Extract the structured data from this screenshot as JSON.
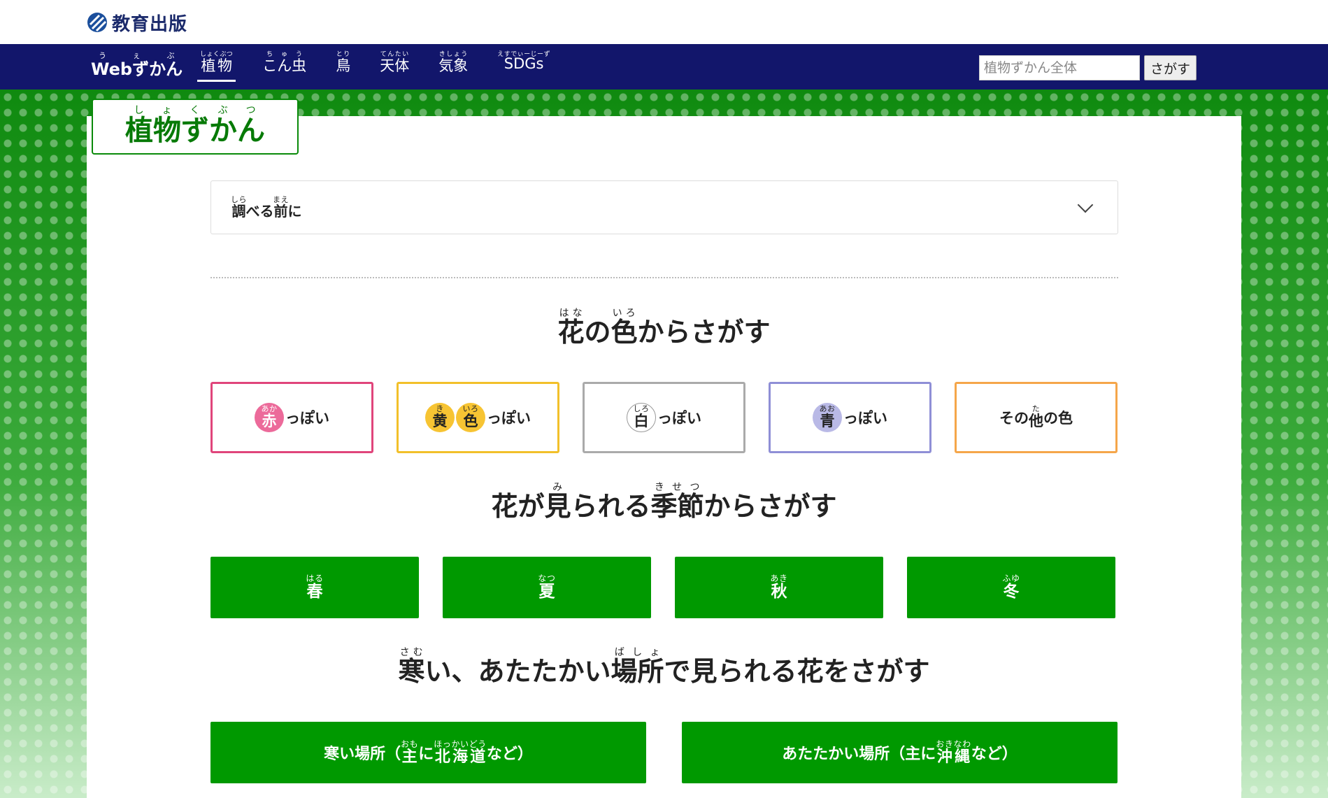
{
  "header": {
    "logo_text": "教育出版",
    "logo_color": "#1b2a6b"
  },
  "nav": {
    "brand": {
      "base": "Webずかん",
      "ruby": "うぇぶ"
    },
    "bg_color": "#12166b",
    "items": [
      {
        "label": "植物",
        "ruby": "しょくぶつ",
        "active": true
      },
      {
        "label": "こん虫",
        "ruby": "ちゅう",
        "active": false
      },
      {
        "label": "鳥",
        "ruby": "とり",
        "active": false
      },
      {
        "label": "天体",
        "ruby": "てんたい",
        "active": false
      },
      {
        "label": "気象",
        "ruby": "きしょう",
        "active": false
      },
      {
        "label": "SDGs",
        "ruby": "えすでぃーじーず",
        "active": false
      }
    ],
    "search": {
      "placeholder": "植物ずかん全体",
      "button_label": "さがす"
    }
  },
  "page_title": {
    "base": "植物ずかん",
    "ruby": "しょくぶつ"
  },
  "accordion": {
    "kanji1": "調",
    "ruby1": "しら",
    "kana1": "べる",
    "kanji2": "前",
    "ruby2": "まえ",
    "kana2": "に"
  },
  "color_section": {
    "heading": {
      "k1": "花",
      "r1": "はな",
      "mid": "の",
      "k2": "色",
      "r2": "いろ",
      "tail": "からさがす"
    },
    "buttons": [
      {
        "kanji": "赤",
        "ruby": "あか",
        "suffix": "っぽい",
        "border": "#e0457b",
        "dot": "#ec6a9a"
      },
      {
        "kanji": "黄",
        "ruby": "き",
        "kanji2": "色",
        "ruby2": "いろ",
        "suffix": "っぽい",
        "border": "#f2c02a",
        "dot": "#f7c433"
      },
      {
        "kanji": "白",
        "ruby": "しろ",
        "suffix": "っぽい",
        "border": "#aaaaaa",
        "dot": "#ffffff"
      },
      {
        "kanji": "青",
        "ruby": "あお",
        "suffix": "っぽい",
        "border": "#8f8fd6",
        "dot": "#b9b9e6"
      },
      {
        "prefix": "その",
        "kanji": "他",
        "ruby": "た",
        "suffix": "の色",
        "border": "#f5a64a"
      }
    ]
  },
  "season_section": {
    "heading": {
      "k1": "花",
      "mid1": "が",
      "k2": "見",
      "r2": "み",
      "mid2": "られる",
      "k3": "季節",
      "r3": "きせつ",
      "tail": "からさがす"
    },
    "buttons": [
      {
        "label": "春",
        "ruby": "はる"
      },
      {
        "label": "夏",
        "ruby": "なつ"
      },
      {
        "label": "秋",
        "ruby": "あき"
      },
      {
        "label": "冬",
        "ruby": "ふゆ"
      }
    ]
  },
  "place_section": {
    "heading": {
      "k1": "寒",
      "r1": "さむ",
      "mid": "い、あたたかい",
      "k2": "場所",
      "r2": "ばしょ",
      "tail": "で見られる花をさがす"
    },
    "buttons": [
      {
        "pre": "寒い場所（",
        "k1": "主",
        "r1": "おも",
        "mid": "に",
        "k2": "北海道",
        "r2": "ほっかいどう",
        "post": "など）"
      },
      {
        "pre": "あたたかい場所（主に",
        "k2": "沖縄",
        "r2": "おきなわ",
        "post": "など）"
      }
    ]
  },
  "colors": {
    "brand_green": "#009900",
    "title_green": "#077a07"
  }
}
